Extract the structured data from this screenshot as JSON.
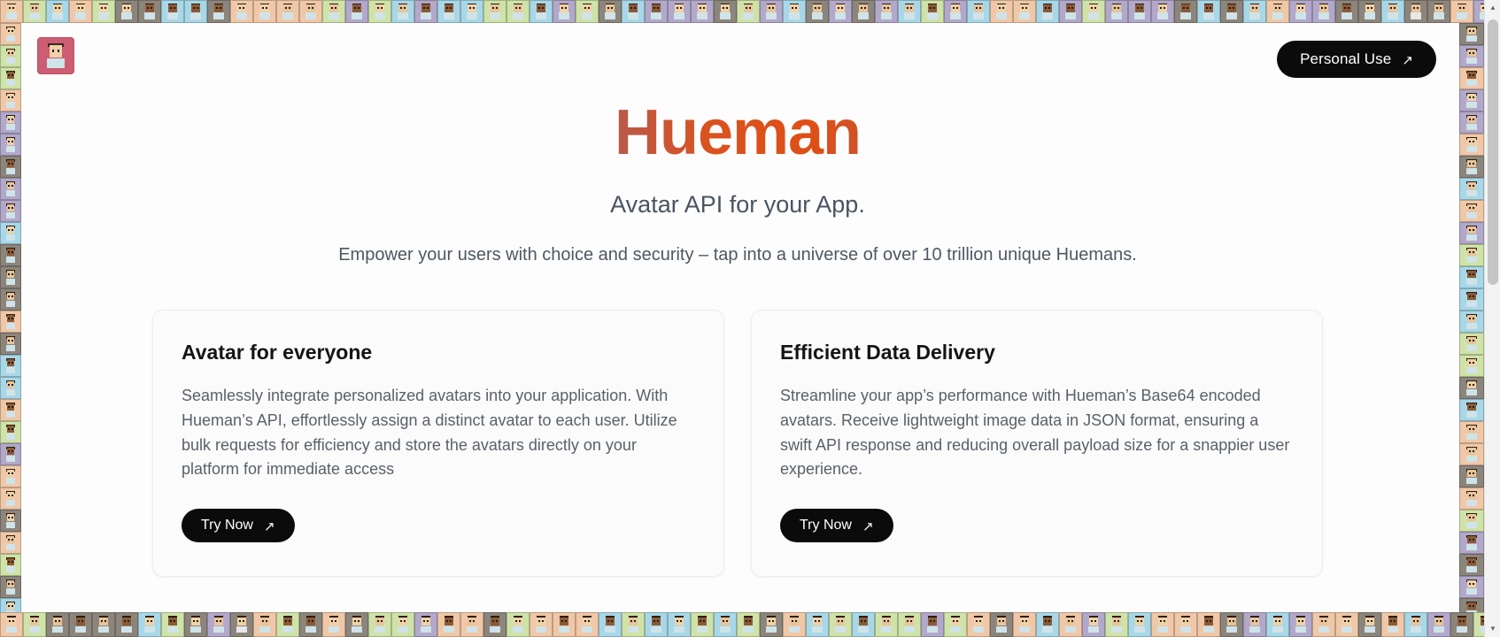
{
  "header": {
    "logo_name": "hueman-avatar-logo",
    "personal_use_label": "Personal Use",
    "arrow_glyph": "↗"
  },
  "hero": {
    "title": "Hueman",
    "subtitle": "Avatar API for your App.",
    "tagline": "Empower your users with choice and security – tap into a universe of over 10 trillion unique Huemans."
  },
  "cards": [
    {
      "title": "Avatar for everyone",
      "body": "Seamlessly integrate personalized avatars into your application. With Hueman’s API, effortlessly assign a distinct avatar to each user. Utilize bulk requests for efficiency and store the avatars directly on your platform for immediate access",
      "cta_label": "Try Now",
      "arrow_glyph": "↗"
    },
    {
      "title": "Efficient Data Delivery",
      "body": "Streamline your app’s performance with Hueman’s Base64 encoded avatars. Receive lightweight image data in JSON format, ensuring a swift API response and reducing overall payload size for a snappier user experience.",
      "cta_label": "Try Now",
      "arrow_glyph": "↗"
    }
  ],
  "scrollbar": {
    "up_glyph": "▲",
    "down_glyph": "▼"
  },
  "colors": {
    "gradient_blue": "#3b6fd4",
    "gradient_purple": "#7c5f96",
    "gradient_orange": "#de4f15",
    "button_black": "#0b0b0b",
    "logo_tile": "#cc5d72",
    "body_text": "#5a6069",
    "heading_text": "#141414"
  },
  "decorative_avatars": {
    "description": "pixel-art avatar border frame",
    "backgrounds": [
      "#8c857c",
      "#e2878b",
      "#d9c6b4",
      "#c9b4d4",
      "#b2a8ca",
      "#8f7f6d",
      "#f0a8b4",
      "#a8e4e0",
      "#cfe3a8",
      "#bcd4c0",
      "#d8d8d8",
      "#e05a5a",
      "#a8d8e8",
      "#e8d8a8",
      "#c8a8d8",
      "#9ecfa8",
      "#f0c8a8",
      "#b8c8e8",
      "#e8a8c8",
      "#a8c8b8"
    ],
    "skins": [
      "#e8c49a",
      "#c98f5e",
      "#8a5a36",
      "#5a3620",
      "#f0d2a8",
      "#d4a373"
    ],
    "hairs": [
      "#2b1d12",
      "#4a3420",
      "#7a4a22",
      "#d9b24a",
      "#222222",
      "#6b3f8f",
      "#1f4f3f",
      "#8a2020"
    ],
    "shirts": [
      "#cfe3e8",
      "#e8e8e8",
      "#3b5a7a",
      "#6a8f5a",
      "#8a4a4a",
      "#d4d4e8",
      "#2a2a2a",
      "#c8a060"
    ]
  }
}
